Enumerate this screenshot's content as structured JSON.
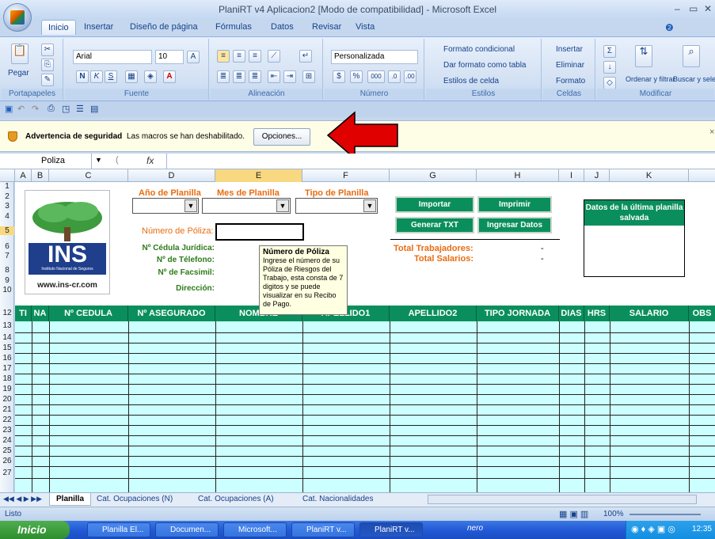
{
  "window": {
    "title": "PlaniRT v4 Aplicacion2  [Modo de compatibilidad] - Microsoft Excel"
  },
  "ribbon": {
    "tabs": [
      "Inicio",
      "Insertar",
      "Diseño de página",
      "Fórmulas",
      "Datos",
      "Revisar",
      "Vista"
    ],
    "active_tab": "Inicio",
    "groups": [
      "Portapapeles",
      "Fuente",
      "Alineación",
      "Número",
      "Estilos",
      "Celdas",
      "Modificar"
    ],
    "paste": "Pegar",
    "font_name": "Arial",
    "font_size": "10",
    "number_format": "Personalizada",
    "styles": [
      "Formato condicional",
      "Dar formato como tabla",
      "Estilos de celda"
    ],
    "cells": [
      "Insertar",
      "Eliminar",
      "Formato"
    ],
    "edit": [
      "Ordenar y filtrar",
      "Buscar y seleccionar"
    ]
  },
  "security": {
    "title": "Advertencia de seguridad",
    "message": "Las macros se han deshabilitado.",
    "options_button": "Opciones..."
  },
  "formula_bar": {
    "name_box": "Poliza",
    "fx": "fx",
    "value": ""
  },
  "columns": [
    "A",
    "B",
    "C",
    "D",
    "E",
    "F",
    "G",
    "H",
    "I",
    "J",
    "K"
  ],
  "rows": [
    "1",
    "2",
    "3",
    "4",
    "5",
    "6",
    "7",
    "8",
    "9",
    "10",
    "12",
    "13",
    "14",
    "15",
    "16",
    "17",
    "18",
    "19",
    "20",
    "21",
    "22",
    "23",
    "24",
    "25",
    "26",
    "27"
  ],
  "form": {
    "ano": "Año de Planilla",
    "mes": "Mes de Planilla",
    "tipo": "Tipo de Planilla",
    "poliza": "Número de Póliza:",
    "cedula": "Nº Cédula Jurídica:",
    "telefono": "Nº de Télefono:",
    "facsimil": "Nº de Facsimil:",
    "direccion": "Dirección:",
    "logo_text": "INS",
    "logo_sub": "Instituto Nacional de Seguros",
    "website": "www.ins-cr.com"
  },
  "buttons": {
    "importar": "Importar",
    "imprimir": "Imprimir",
    "generar": "Generar TXT",
    "ingresar": "Ingresar Datos"
  },
  "totals": {
    "trabajadores_label": "Total Trabajadores:",
    "salarios_label": "Total Salarios:",
    "trabajadores_value": "-",
    "salarios_value": "-"
  },
  "datos": {
    "title": "Datos de la última planilla salvada"
  },
  "tooltip": {
    "title": "Número de Póliza",
    "body": "Ingrese el número de su Póliza de Riesgos del Trabajo, esta consta de 7 digitos y se puede visualizar en su Recibo de Pago."
  },
  "table_headers": [
    "TI",
    "NA",
    "Nº CEDULA",
    "Nº ASEGURADO",
    "NOMBRE",
    "APELLIDO1",
    "APELLIDO2",
    "TIPO JORNADA",
    "DIAS",
    "HRS",
    "SALARIO",
    "OBS"
  ],
  "sheet_tabs": [
    "Planilla",
    "Cat. Ocupaciones (N)",
    "Cat. Ocupaciones (A)",
    "Cat. Nacionalidades"
  ],
  "status": {
    "ready": "Listo",
    "zoom": "100%"
  },
  "taskbar": {
    "start": "Inicio",
    "items": [
      "Planilla El...",
      "Documen...",
      "Microsoft...",
      "PlaniRT v...",
      "PlaniRT v..."
    ],
    "clock": "12:35"
  }
}
